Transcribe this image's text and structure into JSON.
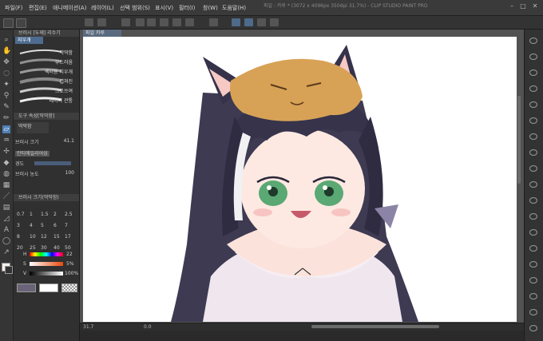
{
  "window": {
    "title": "파일 : 카루 * (3072 x 4096px 350dpi 31.7%) - CLIP STUDIO PAINT PRO"
  },
  "menu": [
    "파일(F)",
    "편집(E)",
    "애니메이션(A)",
    "레이어(L)",
    "선택 범위(S)",
    "표시(V)",
    "필터(I)",
    "창(W)",
    "도움말(H)"
  ],
  "subtool_panel": {
    "header": "브러시 [두께] 리수기",
    "active_tab": "지우개",
    "brushes": [
      "딱딱함",
      "부드러움",
      "벡터용 지우개",
      "겹쳐진",
      "크로쓰여",
      "레이어 관통"
    ]
  },
  "tool_property": {
    "header": "도구 속성[딱딱함]",
    "brush_name": "딱딱함",
    "brush_size_label": "브러시 크기",
    "brush_size_value": "41.1",
    "anti_alias_label": "안티에일리어싱",
    "hardness_label": "경도",
    "density_label": "브러시 농도",
    "density_value": "100"
  },
  "brush_size_panel": {
    "header": "브러시 크기(딱딱함)",
    "sizes": [
      "0.7",
      "1",
      "1.5",
      "2",
      "2.5",
      "3",
      "4",
      "5",
      "6",
      "7",
      "8",
      "10",
      "12",
      "15",
      "17",
      "20",
      "25",
      "30",
      "40",
      "50"
    ]
  },
  "color_panel": {
    "h_label": "H",
    "h_value": "22",
    "s_label": "S",
    "s_value": "5%",
    "v_label": "V",
    "v_value": "100%"
  },
  "canvas_tab": {
    "label": "파일 카루"
  },
  "status": {
    "zoom": "31.7",
    "rotation": "0.0"
  },
  "colors": {
    "accent": "#5a6a7f",
    "canvas": "#ffffff",
    "background": "#2b2b2b"
  }
}
